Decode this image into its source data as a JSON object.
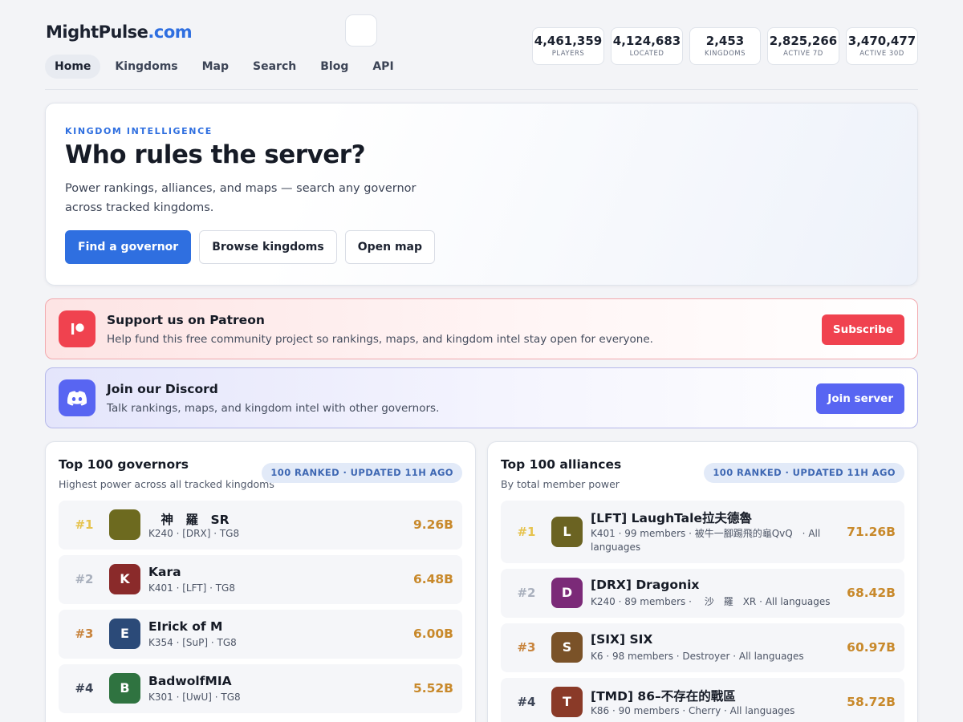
{
  "site": {
    "brand": "MightPulse",
    "tld": ".com"
  },
  "nav": {
    "items": [
      {
        "label": "Home",
        "active": true
      },
      {
        "label": "Kingdoms",
        "active": false
      },
      {
        "label": "Map",
        "active": false
      },
      {
        "label": "Search",
        "active": false
      },
      {
        "label": "Blog",
        "active": false
      },
      {
        "label": "API",
        "active": false
      }
    ]
  },
  "stats": [
    {
      "value": "4,461,359",
      "label": "PLAYERS"
    },
    {
      "value": "4,124,683",
      "label": "LOCATED"
    },
    {
      "value": "2,453",
      "label": "KINGDOMS"
    },
    {
      "value": "2,825,266",
      "label": "ACTIVE 7D"
    },
    {
      "value": "3,470,477",
      "label": "ACTIVE 30D"
    }
  ],
  "hero": {
    "eyebrow": "KINGDOM INTELLIGENCE",
    "title": "Who rules the server?",
    "description": "Power rankings, alliances, and maps — search any governor across tracked kingdoms.",
    "primary_button": "Find a governor",
    "secondary_button": "Browse kingdoms",
    "tertiary_button": "Open map"
  },
  "patreon": {
    "title": "Support us on Patreon",
    "description": "Help fund this free community project so rankings, maps, and kingdom intel stay open for everyone.",
    "button": "Subscribe",
    "color": "#f0424f"
  },
  "discord": {
    "title": "Join our Discord",
    "description": "Talk rankings, maps, and kingdom intel with other governors.",
    "button": "Join server",
    "color": "#5865f2"
  },
  "governors": {
    "title": "Top 100 governors",
    "subtitle": "Highest power across all tracked kingdoms",
    "badge": "100 RANKED · UPDATED 11H AGO",
    "rows": [
      {
        "rank": "#1",
        "initial": "",
        "name": "　神　羅　SR",
        "meta": "K240 · [DRX] · TG8",
        "power": "9.26B",
        "avatar_color": "#6d6a1f"
      },
      {
        "rank": "#2",
        "initial": "K",
        "name": "Kara",
        "meta": "K401 · [LFT] · TG8",
        "power": "6.48B",
        "avatar_color": "#8a2a2a"
      },
      {
        "rank": "#3",
        "initial": "E",
        "name": "EIrick of M",
        "meta": "K354 · [SuP] · TG8",
        "power": "6.00B",
        "avatar_color": "#2b4a78"
      },
      {
        "rank": "#4",
        "initial": "B",
        "name": "BadwolfMIA",
        "meta": "K301 · [UwU] · TG8",
        "power": "5.52B",
        "avatar_color": "#2f7340"
      }
    ]
  },
  "alliances": {
    "title": "Top 100 alliances",
    "subtitle": "By total member power",
    "badge": "100 RANKED · UPDATED 11H AGO",
    "rows": [
      {
        "rank": "#1",
        "initial": "L",
        "name": "[LFT] LaughTale拉夫德魯",
        "meta": "K401 · 99 members · 被牛一腳踢飛的龜QvQ　· All languages",
        "power": "71.26B",
        "avatar_color": "#6b6322"
      },
      {
        "rank": "#2",
        "initial": "D",
        "name": "[DRX] Dragonix",
        "meta": "K240 · 89 members · 　沙　羅　XR · All languages",
        "power": "68.42B",
        "avatar_color": "#7b2a78"
      },
      {
        "rank": "#3",
        "initial": "S",
        "name": "[SIX] SIX",
        "meta": "K6 · 98 members · Destroyer · All languages",
        "power": "60.97B",
        "avatar_color": "#7a5228"
      },
      {
        "rank": "#4",
        "initial": "T",
        "name": "[TMD] 86–不存在的戰區",
        "meta": "K86 · 90 members · Cherry · All languages",
        "power": "58.72B",
        "avatar_color": "#8a3a28"
      }
    ]
  }
}
